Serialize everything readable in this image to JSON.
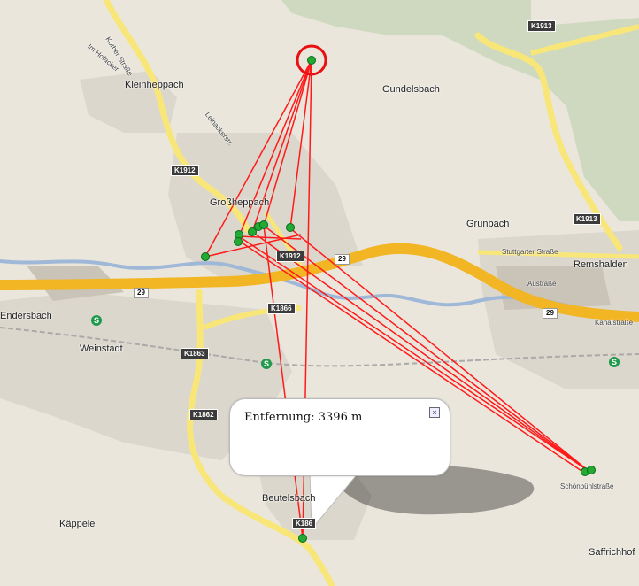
{
  "popup": {
    "distance_text": "Entfernung: 3396 m",
    "close_symbol": "×"
  },
  "places": {
    "kleinheppach": "Kleinheppach",
    "gundelsbach": "Gundelsbach",
    "grossheppach": "Großheppach",
    "grunbach": "Grunbach",
    "remshalden": "Remshalden",
    "endersbach": "Endersbach",
    "weinstadt": "Weinstadt",
    "beutelsbach": "Beutelsbach",
    "kappele": "Käppele",
    "saffrichhof": "Saffrichhof"
  },
  "streets": {
    "korber": "Korber Straße",
    "hofacker": "Im Hofacker",
    "leinackerstr": "Leinackerstr.",
    "stuttgarter": "Stuttgarter Straße",
    "austrasse": "Austraße",
    "kanalstrasse": "Kanalstraße",
    "schoenbuehl": "Schönbühlstraße"
  },
  "roads": {
    "k1913_top": "K1913",
    "k1913_right": "K1913",
    "k1912_left": "K1912",
    "k1912_center": "K1912",
    "k1866": "K1866",
    "k1863": "K1863",
    "k1862": "K1862",
    "k1865": "K186",
    "b29_center": "29",
    "b29_left": "29",
    "b29_right": "29"
  },
  "sbahn_symbol": "S",
  "colors": {
    "route": "#ff1a1a",
    "marker": "#22aa33",
    "highway": "#f2b524",
    "road": "#f9e678",
    "river": "#9fb8d8"
  }
}
